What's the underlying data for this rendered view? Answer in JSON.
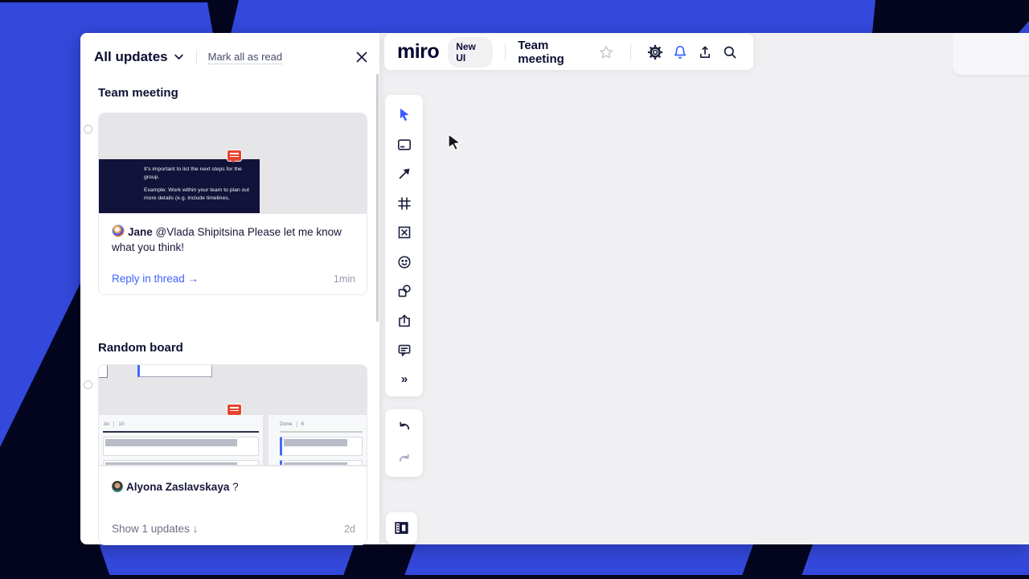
{
  "topbar": {
    "logo": "miro",
    "new_ui_badge": "New UI",
    "board_title": "Team meeting"
  },
  "panel": {
    "title": "All updates",
    "mark_all_label": "Mark all as read"
  },
  "sections": [
    {
      "board": "Team meeting",
      "note_line1": "It's important to list the next steps for the group.",
      "note_line2": "Example: Work within your team to plan out more details (e.g. include timelines,",
      "author": "Jane",
      "message": "@Vlada Shipitsina Please let me know what you think!",
      "action": "Reply in thread →",
      "time": "1min"
    },
    {
      "board": "Random board",
      "author": "Alyona Zaslavskaya",
      "message": "?",
      "action": "Show 1 updates ↓",
      "time": "2d",
      "kanban": {
        "col1_label": "do",
        "col1_count": "10",
        "col2_label": "Done",
        "col2_count": "6"
      }
    }
  ],
  "icons": {
    "more_tools": "»"
  },
  "colors": {
    "brand_blue": "#3349dc",
    "dark_navy": "#04051e",
    "accent_blue": "#4262ff",
    "alert_red": "#e5452e",
    "canvas_gray": "#f0f0f2"
  }
}
